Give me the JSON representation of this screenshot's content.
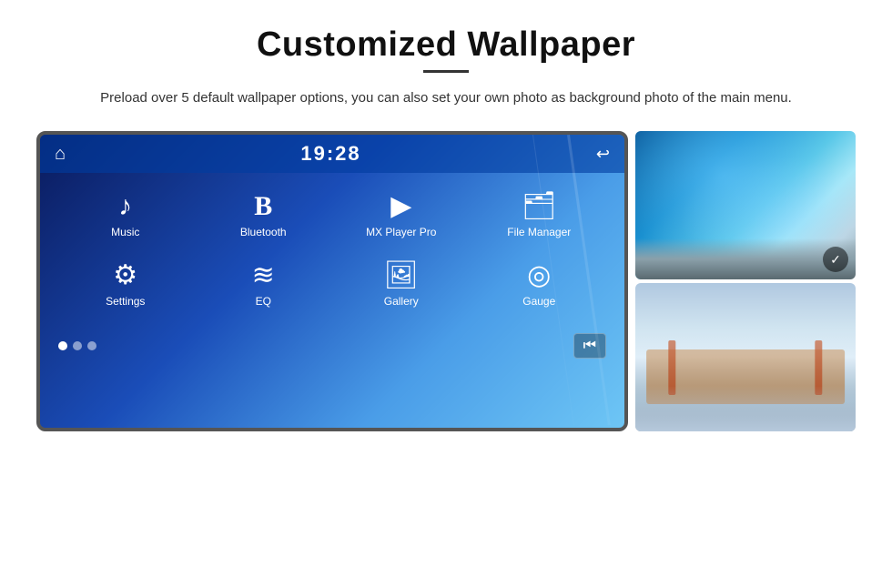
{
  "header": {
    "title": "Customized Wallpaper",
    "subtitle": "Preload over 5 default wallpaper options, you can also set your own photo as background photo of the main menu."
  },
  "screen": {
    "time": "19:28",
    "apps_row1": [
      {
        "label": "Music",
        "icon": "♪"
      },
      {
        "label": "Bluetooth",
        "icon": "Ᵽ"
      },
      {
        "label": "MX Player Pro",
        "icon": "▶"
      },
      {
        "label": "File Manager",
        "icon": "📁"
      }
    ],
    "apps_row2": [
      {
        "label": "Settings",
        "icon": "⚙"
      },
      {
        "label": "EQ",
        "icon": "≡"
      },
      {
        "label": "Gallery",
        "icon": "🖼"
      },
      {
        "label": "Gauge",
        "icon": "⊙"
      }
    ],
    "dots": [
      true,
      false,
      false
    ]
  },
  "thumbnails": [
    {
      "id": "ice-cave",
      "alt": "Ice cave thumbnail"
    },
    {
      "id": "golden-gate",
      "alt": "Golden Gate Bridge thumbnail"
    }
  ],
  "icons": {
    "home": "⌂",
    "back": "↩",
    "music_note": "♪",
    "bluetooth": "Ᵽ",
    "play": "▶",
    "folder": "🗂",
    "settings": "⚙",
    "equalizer": "≋",
    "gallery": "🖼",
    "gauge": "◎",
    "skip_back": "⏮",
    "check": "✓"
  }
}
